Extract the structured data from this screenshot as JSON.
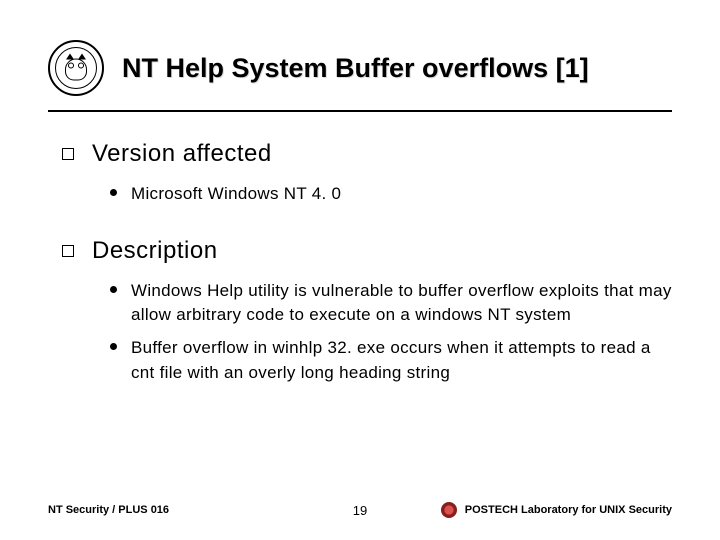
{
  "title": "NT Help System Buffer overflows [1]",
  "sections": [
    {
      "heading": "Version affected",
      "items": [
        "Microsoft Windows NT 4. 0"
      ]
    },
    {
      "heading": "Description",
      "items": [
        "Windows Help utility is vulnerable to buffer overflow exploits that may allow arbitrary code to execute on a windows NT system",
        "Buffer overflow in winhlp 32. exe occurs when it attempts to read a cnt file with an overly long heading string"
      ]
    }
  ],
  "footer": {
    "left": "NT Security / PLUS 016",
    "page": "19",
    "right": "POSTECH Laboratory for UNIX Security"
  }
}
